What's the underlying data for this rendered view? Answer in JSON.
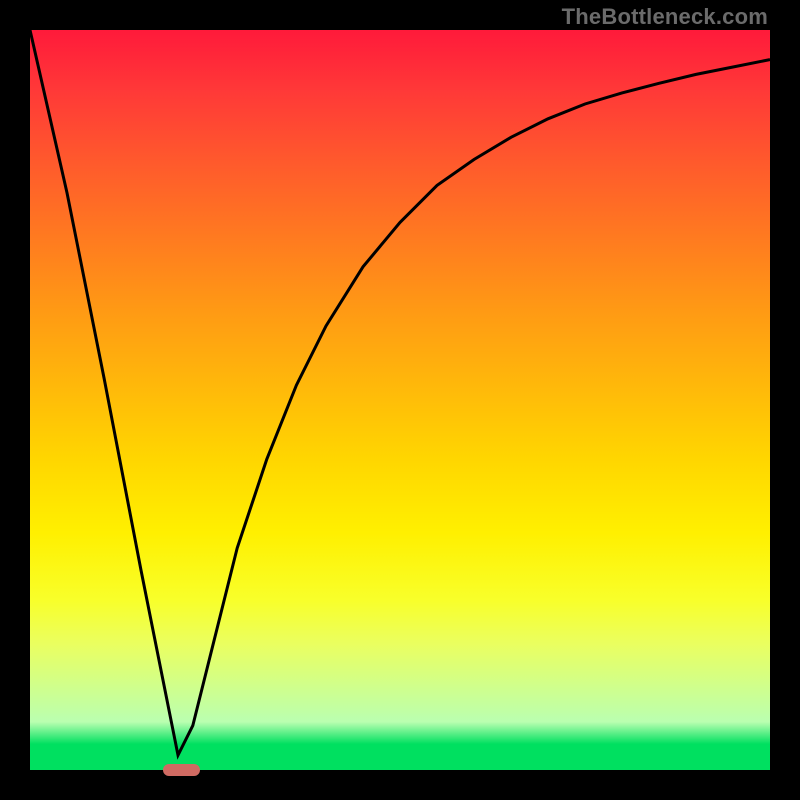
{
  "watermark": "TheBottleneck.com",
  "chart_data": {
    "type": "line",
    "title": "",
    "xlabel": "",
    "ylabel": "",
    "xlim": [
      0,
      100
    ],
    "ylim": [
      0,
      100
    ],
    "grid": false,
    "colors": {
      "curve": "#000000",
      "marker": "#cf6a62",
      "gradient_top": "#ff1a3a",
      "gradient_bottom": "#00e060"
    },
    "marker": {
      "x_start": 18,
      "x_end": 23,
      "y": 0
    },
    "series": [
      {
        "name": "curve",
        "x": [
          0,
          5,
          10,
          15,
          18,
          20,
          22,
          25,
          28,
          32,
          36,
          40,
          45,
          50,
          55,
          60,
          65,
          70,
          75,
          80,
          85,
          90,
          95,
          100
        ],
        "values": [
          100,
          78,
          53,
          27,
          12,
          2,
          6,
          18,
          30,
          42,
          52,
          60,
          68,
          74,
          79,
          82.5,
          85.5,
          88,
          90,
          91.5,
          92.8,
          94,
          95,
          96
        ]
      }
    ]
  }
}
